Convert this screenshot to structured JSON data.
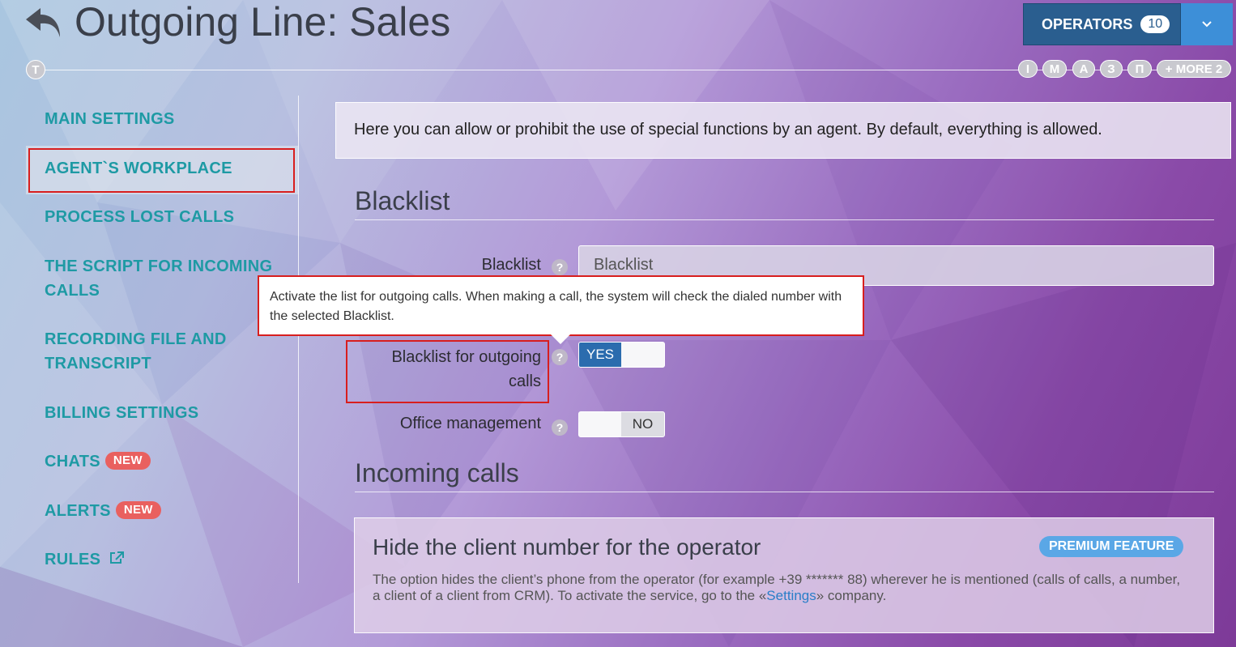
{
  "header": {
    "title": "Outgoing Line: Sales",
    "avatar_letter": "T",
    "quick_initials": [
      "I",
      "М",
      "А",
      "З",
      "П"
    ],
    "more_label": "+ MORE 2",
    "operators_label": "OPERATORS",
    "operators_count": "10"
  },
  "sidebar": {
    "items": [
      {
        "label": "MAIN SETTINGS"
      },
      {
        "label": "AGENT`S WORKPLACE"
      },
      {
        "label": "PROCESS LOST CALLS"
      },
      {
        "label": "THE SCRIPT FOR INCOMING CALLS"
      },
      {
        "label": "RECORDING FILE AND TRANSCRIPT"
      },
      {
        "label": "BILLING SETTINGS"
      },
      {
        "label": "CHATS",
        "badge": "NEW"
      },
      {
        "label": "ALERTS",
        "badge": "NEW"
      },
      {
        "label": "RULES"
      }
    ]
  },
  "info": "Here you can allow or prohibit the use of special functions by an agent. By default, everything is allowed.",
  "blacklist_section": {
    "heading": "Blacklist",
    "select_label": "Blacklist",
    "select_value": "Blacklist",
    "tooltip": "Activate the list for outgoing calls. When making a call, the system will check the dialed number with the selected Blacklist.",
    "outgoing_label": "Blacklist for outgoing calls",
    "outgoing_value": "YES",
    "office_label": "Office management",
    "office_value": "NO"
  },
  "incoming_section": {
    "heading": "Incoming calls",
    "card_title": "Hide the client number for the operator",
    "badge": "PREMIUM FEATURE",
    "text_before": "The option hides the client’s phone from the operator (for example +39 ******* 88) wherever he is mentioned (calls of calls, a number, a client of a client from CRM). To activate the service, go to the «",
    "link": "Settings",
    "text_after": "» company."
  },
  "icons": [
    "back-arrow-icon",
    "chevron-down-icon",
    "question-icon",
    "external-link-icon"
  ],
  "colors": {
    "nav": "#1e9aa4",
    "operators": "#2a5e8f",
    "toggle_on": "#2b6cae",
    "new_badge": "#e9605f",
    "premium": "#5aa7e6",
    "highlight": "#d81e1e"
  }
}
